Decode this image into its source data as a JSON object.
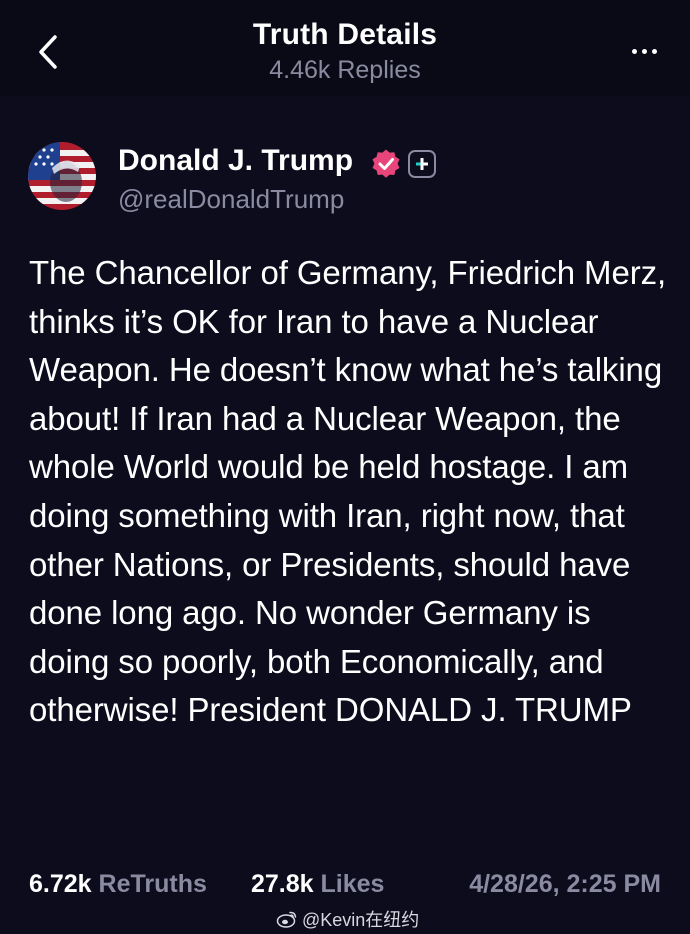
{
  "header": {
    "title": "Truth Details",
    "subtitle": "4.46k Replies",
    "back_icon": "chevron-left-icon",
    "more_icon": "more-horizontal-icon"
  },
  "post": {
    "author": {
      "display_name": "Donald J. Trump",
      "handle": "@realDonaldTrump",
      "verified_icon": "verified-badge-icon",
      "verified_color": "#e8457a",
      "plus_icon": "plus-badge-icon"
    },
    "text": "The Chancellor of Germany, Friedrich Merz, thinks it’s OK for Iran to have a Nuclear Weapon. He doesn’t know what he’s talking about! If Iran had a Nuclear Weapon, the whole World would be held hostage. I am doing something with Iran, right now, that other Nations, or Presidents, should have done long ago. No wonder Germany is doing so poorly, both Economically, and otherwise! President DONALD J. TRUMP",
    "stats": {
      "retruths_count": "6.72k",
      "retruths_label": "ReTruths",
      "likes_count": "27.8k",
      "likes_label": "Likes",
      "timestamp": "4/28/26, 2:25 PM"
    }
  },
  "watermark": {
    "text": "@Kevin在纽约",
    "icon": "weibo-icon"
  },
  "colors": {
    "background": "#0d0c1d",
    "header_background": "#0a0a17",
    "text_primary": "#ffffff",
    "text_secondary": "#8a8aa0"
  }
}
